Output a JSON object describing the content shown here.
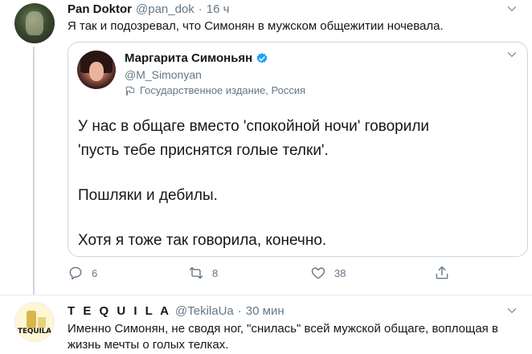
{
  "tweet1": {
    "name": "Pan Doktor",
    "handle": "@pan_dok",
    "separator": "·",
    "time": "16 ч",
    "text": "Я так и подозревал, что Симонян в мужском общежитии ночевала.",
    "quote": {
      "name": "Маргарита Симоньян",
      "handle": "@M_Simonyan",
      "label": "Государственное издание, Россия",
      "lines": [
        "У нас в общаге вместо 'спокойной ночи' говорили",
        "'пусть тебе приснятся голые телки'.",
        "Пошляки и дебилы.",
        "Хотя я тоже так говорила, конечно."
      ]
    },
    "actions": {
      "reply_count": "6",
      "retweet_count": "8",
      "like_count": "38"
    }
  },
  "tweet2": {
    "name": "T E Q U I L A",
    "handle": "@TekilaUa",
    "separator": "·",
    "time": "30 мин",
    "avatar_text": "TEQUILA",
    "text": "Именно Симонян, не сводя ног, \"снилась\" всей мужской общаге, воплощая в жизнь мечты о  голых телках."
  },
  "colors": {
    "text": "#14171a",
    "secondary": "#657786",
    "border": "#ccd6dd",
    "verified": "#1da1f2"
  }
}
